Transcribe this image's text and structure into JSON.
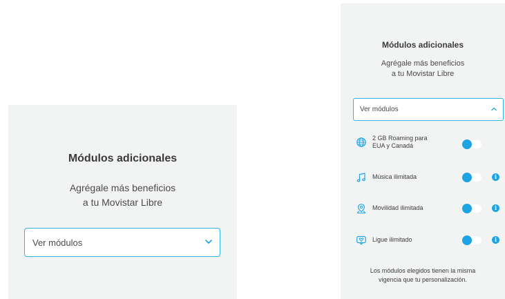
{
  "left_panel": {
    "title": "Módulos adicionales",
    "subtitle_line1": "Agrégale más beneficios",
    "subtitle_line2": "a tu Movistar Libre",
    "dropdown": {
      "label": "Ver módulos",
      "state": "collapsed",
      "icon": "chevron-down-icon"
    }
  },
  "right_panel": {
    "title": "Módulos adicionales",
    "subtitle_line1": "Agrégale más beneficios",
    "subtitle_line2": "a tu Movistar Libre",
    "dropdown": {
      "label": "Ver módulos",
      "state": "expanded",
      "icon": "chevron-up-icon"
    },
    "modules": [
      {
        "label_line1": "2 GB Roaming para",
        "label_line2": "EUA y Canadá",
        "icon": "globe-icon",
        "enabled": false,
        "has_info": false
      },
      {
        "label_line1": "Música ilimitada",
        "label_line2": "",
        "icon": "music-note-icon",
        "enabled": false,
        "has_info": true
      },
      {
        "label_line1": "Movilidad ilimitada",
        "label_line2": "",
        "icon": "location-pin-icon",
        "enabled": false,
        "has_info": true
      },
      {
        "label_line1": "Ligue ilimitado",
        "label_line2": "",
        "icon": "chat-heart-icon",
        "enabled": false,
        "has_info": true
      }
    ],
    "info_glyph": "i",
    "footnote_line1": "Los módulos elegidos tienen la misma",
    "footnote_line2": "vigencia que tu personalización."
  },
  "colors": {
    "panel_background": "#f2f3f3",
    "accent": "#1ea4e2",
    "border": "#2fb4e6",
    "text": "#3c3c3c"
  }
}
